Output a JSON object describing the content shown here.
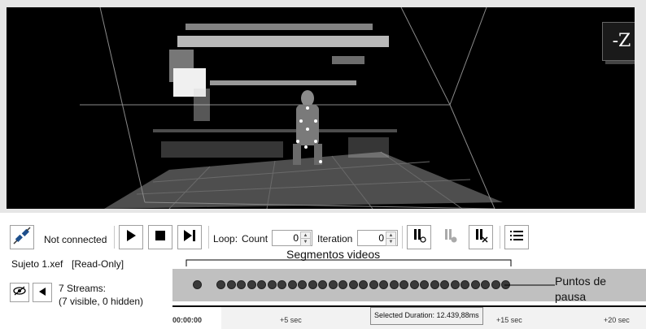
{
  "viewport": {
    "view_cube_label": "-Z",
    "background": "#000000",
    "floor_color": "#555555"
  },
  "connection": {
    "icon": "plug-icon",
    "status": "Not connected"
  },
  "playback": {
    "play_icon": "play-icon",
    "stop_icon": "stop-icon",
    "step_icon": "step-forward-icon"
  },
  "loop": {
    "label": "Loop:",
    "count_label": "Count",
    "count_value": "0",
    "iteration_label": "Iteration",
    "iteration_value": "0"
  },
  "pause_tools": {
    "add_icon": "add-pause-point-icon",
    "toggle_icon": "toggle-pause-point-icon",
    "remove_icon": "remove-pause-point-icon",
    "list_icon": "list-icon"
  },
  "file": {
    "name": "Sujeto 1.xef",
    "mode": "[Read-Only]"
  },
  "streams": {
    "visibility_icon": "eye-icon",
    "expand_icon": "expand-triangle-icon",
    "summary": "7 Streams:",
    "detail": "(7 visible, 0 hidden)"
  },
  "annotations": {
    "segments": "Segmentos videos",
    "pause_points_line1": "Puntos de",
    "pause_points_line2": "pausa"
  },
  "timeline": {
    "pause_point_count": 30
  },
  "ruler": {
    "start": "00:00:00",
    "t5": "+5 sec",
    "t15": "+15 sec",
    "t20": "+20 sec"
  },
  "tooltip": {
    "text": "Selected Duration: 12.439,88ms"
  }
}
